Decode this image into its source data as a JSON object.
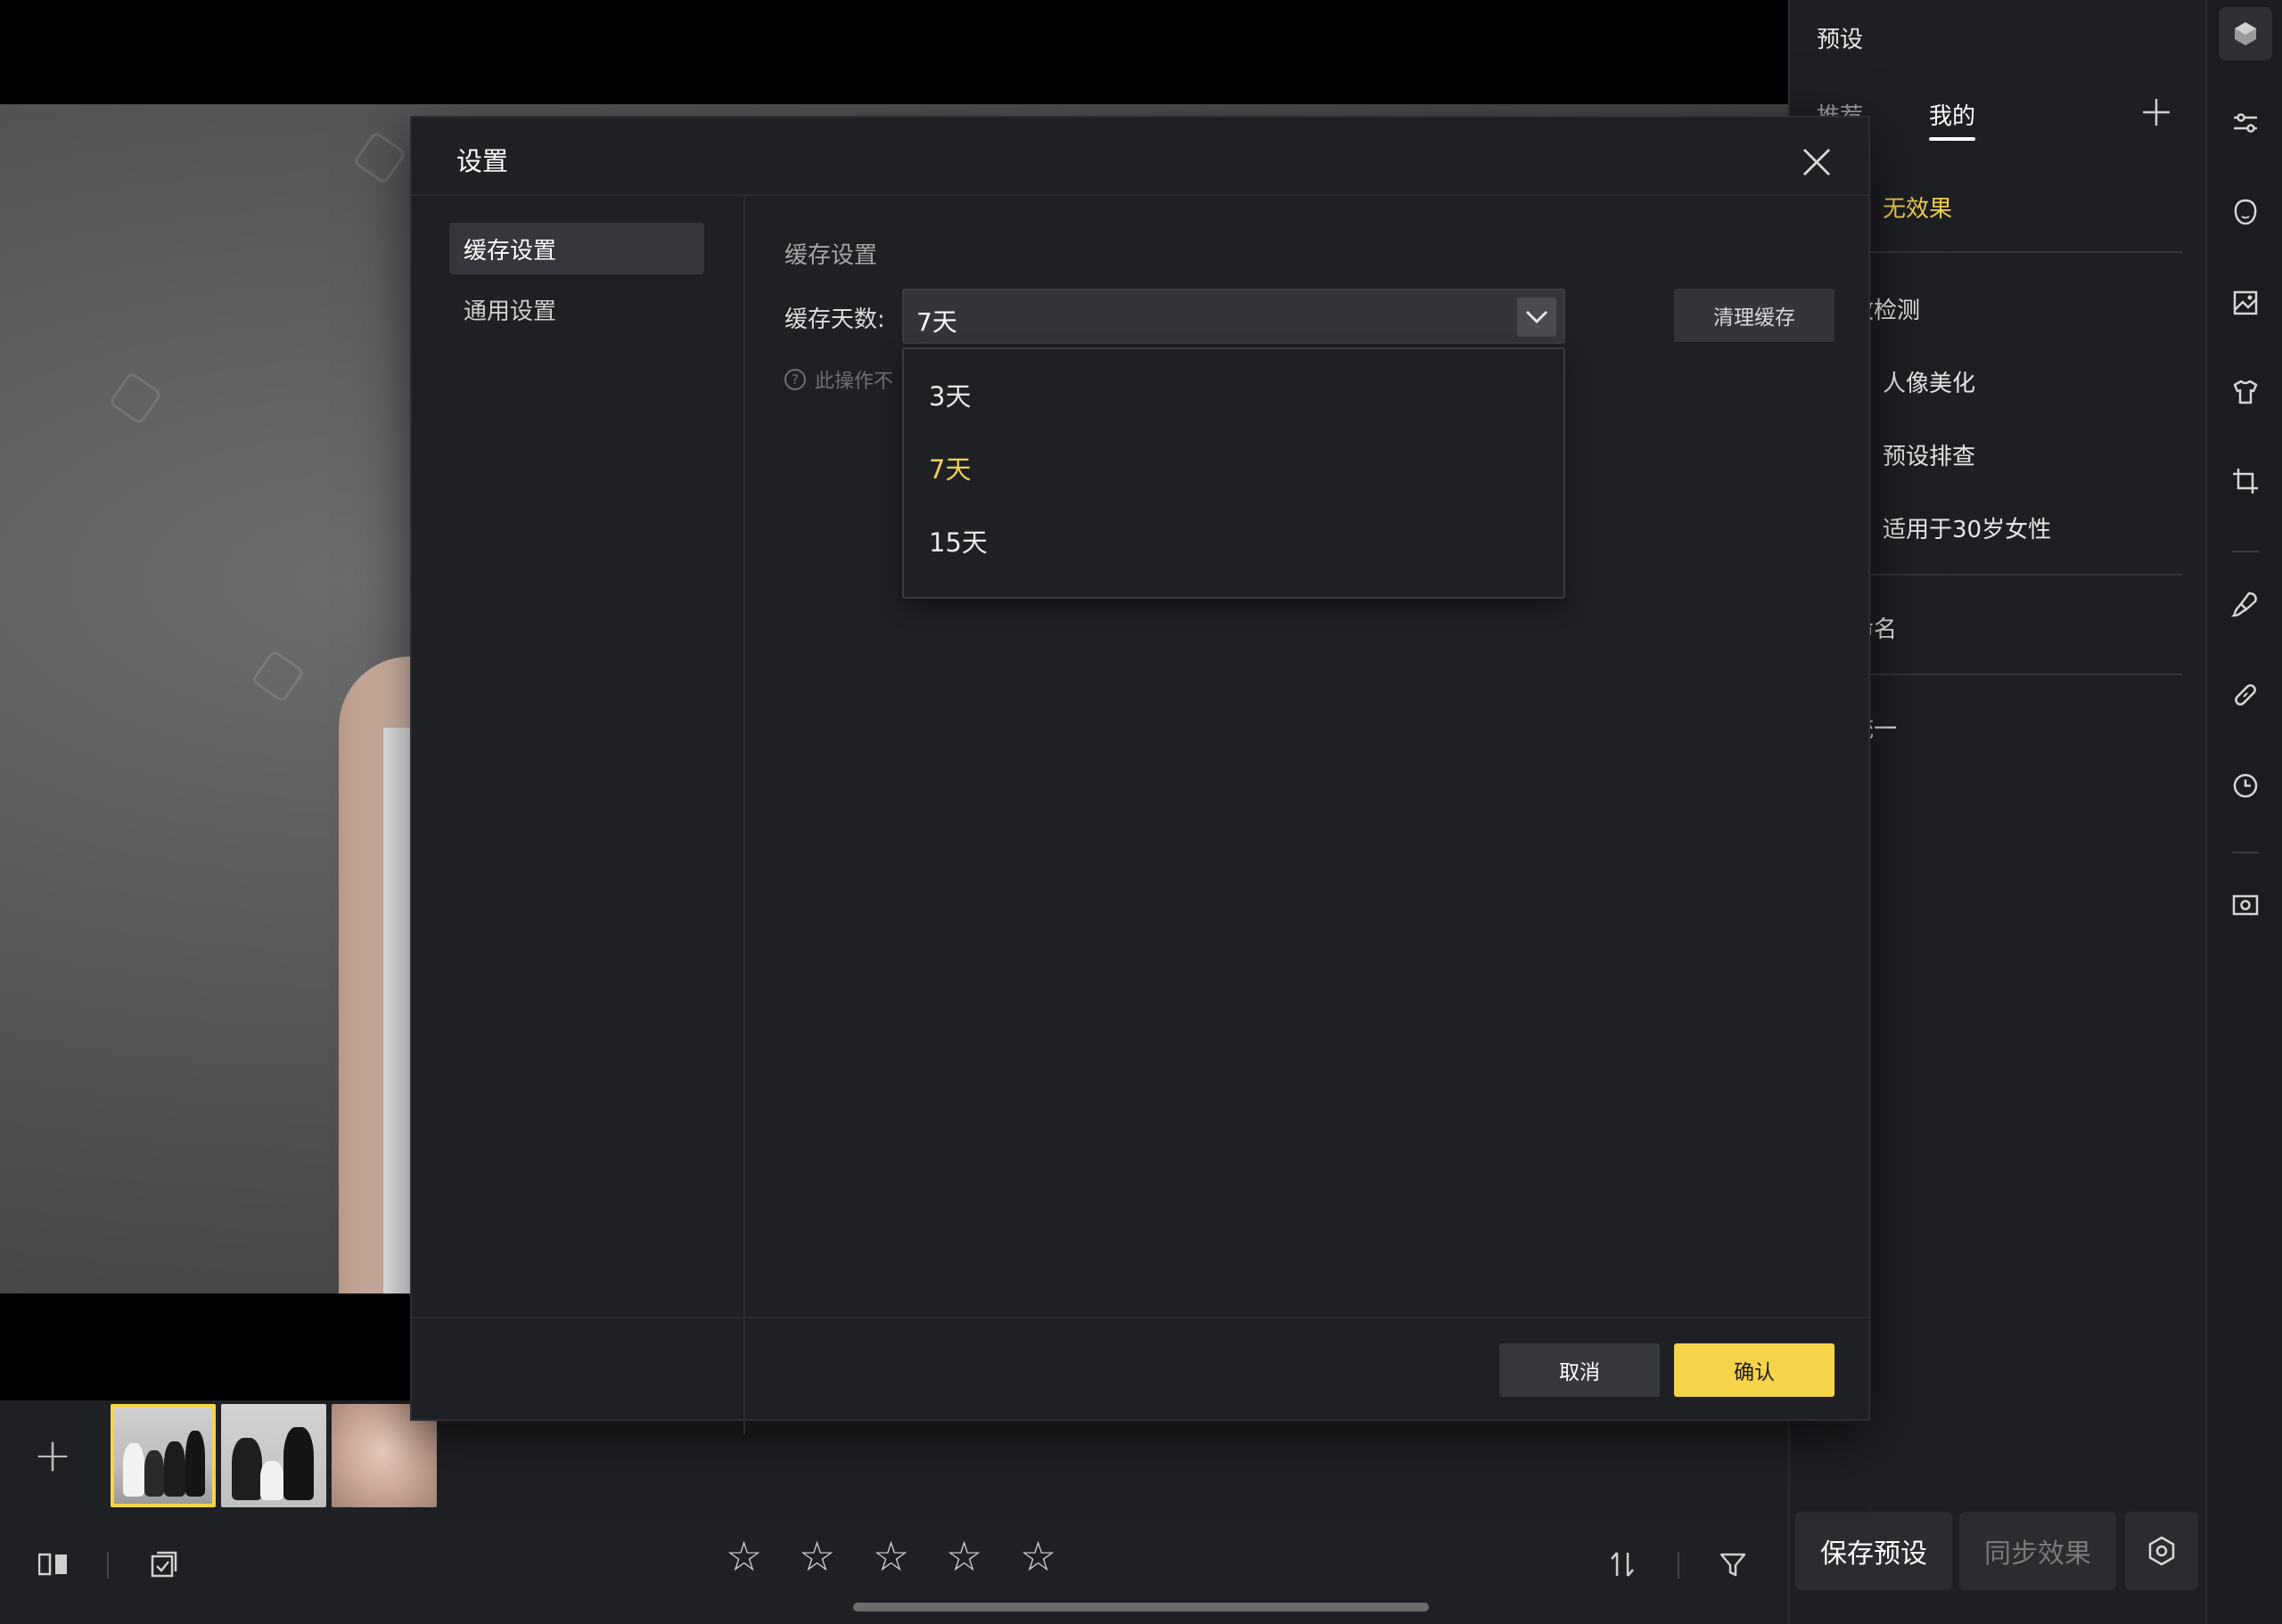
{
  "right_panel": {
    "title": "预设",
    "tabs": [
      {
        "label": "推荐",
        "active": false
      },
      {
        "label": "我的",
        "active": true
      }
    ],
    "items": {
      "no_effect": "无效果",
      "detect": "效检测",
      "portrait_beauty": "人像美化",
      "preset_check": "预设排查",
      "age30_female": "适用于30岁女性",
      "naming": "命名",
      "unify": "统一"
    },
    "save_preset": "保存预设",
    "sync_effect": "同步效果"
  },
  "bottom_bar": {
    "star_glyph": "☆",
    "rating_max": 5
  },
  "filmstrip": {
    "add_label": "+"
  },
  "dialog": {
    "title": "设置",
    "nav": [
      {
        "label": "缓存设置",
        "active": true
      },
      {
        "label": "通用设置",
        "active": false
      }
    ],
    "section_title": "缓存设置",
    "cache_days_label": "缓存天数:",
    "cache_days_value": "7天",
    "clear_cache": "清理缓存",
    "hint": "此操作不",
    "options": [
      {
        "label": "3天",
        "selected": false
      },
      {
        "label": "7天",
        "selected": true
      },
      {
        "label": "15天",
        "selected": false
      }
    ],
    "cancel": "取消",
    "confirm": "确认"
  },
  "colors": {
    "accent": "#f5d44a",
    "panel_bg": "#1f2024",
    "control_bg": "#34353a"
  },
  "icons": {
    "close": "close-icon",
    "dropdown": "chevron-down-icon",
    "hint": "question-circle-icon",
    "rail": [
      "app-logo-icon",
      "sliders-icon",
      "face-outline-icon",
      "image-icon",
      "clothing-icon",
      "crop-icon",
      "brush-icon",
      "bandage-icon",
      "history-clock-icon",
      "camera-icon"
    ]
  }
}
